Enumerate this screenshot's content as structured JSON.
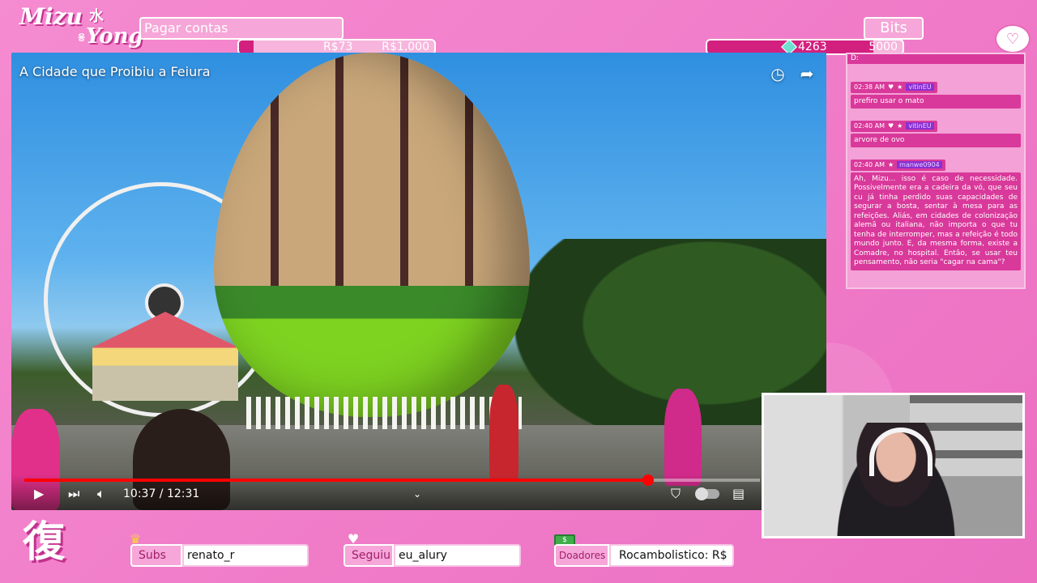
{
  "logo": {
    "line1": "Mizu",
    "kanji": "水",
    "line2": "Yong",
    "small": "용"
  },
  "goal": {
    "title": "Pagar contas",
    "current": "R$73",
    "target": "R$1,000",
    "progress": 0.073
  },
  "bits": {
    "label": "Bits",
    "current": "4263",
    "target": "5000",
    "progress": 0.8526
  },
  "video": {
    "title": "A Cidade que Proibiu a Feiura",
    "time": "10:37 / 12:31",
    "progress": 0.8482
  },
  "chat": {
    "top_text": "D:",
    "messages": [
      {
        "time": "02:38 AM",
        "user": "vitinEU",
        "body": "prefiro usar o mato"
      },
      {
        "time": "02:40 AM",
        "user": "vitinEU",
        "body": "arvore de ovo"
      },
      {
        "time": "02:40 AM",
        "user": "manwe0904",
        "body": "Ah, Mizu... isso é caso de necessidade. Possivelmente era a cadeira da vó, que seu cu já tinha perdido suas capacidades de segurar a bosta, sentar à mesa para as refeições. Aliás, em cidades de colonização alemã ou italiana, não importa o que tu tenha de interromper, mas a refeição é todo mundo junto. E, da mesma forma, existe a Comadre, no hospital. Então, se usar teu pensamento, não seria \"cagar na cama\"?"
      }
    ]
  },
  "bottom": {
    "kanji": "復",
    "subs": {
      "label": "Subs",
      "value": "renato_r"
    },
    "follow": {
      "label": "Seguiu",
      "value": "eu_alury"
    },
    "donors": {
      "label": "Doadores",
      "value": "Rocambolistico: R$"
    }
  },
  "colors": {
    "accent": "#d3207f",
    "bg": "#f07dc8",
    "progress_red": "#ff0000"
  }
}
